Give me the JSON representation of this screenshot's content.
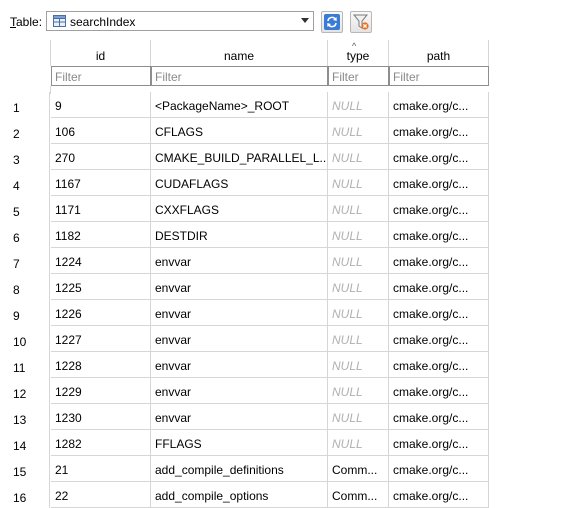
{
  "toolbar": {
    "table_label": "Table:",
    "table_label_accel": "T",
    "table_label_rest": "able:",
    "selected_table": "searchIndex",
    "refresh_icon": "refresh-icon",
    "clear_filter_icon": "filter-clear-icon"
  },
  "columns": [
    {
      "label": "id",
      "filter_placeholder": "Filter"
    },
    {
      "label": "name",
      "filter_placeholder": "Filter"
    },
    {
      "label": "type",
      "filter_placeholder": "Filter",
      "sorted": "ascending"
    },
    {
      "label": "path",
      "filter_placeholder": "Filter"
    }
  ],
  "rows": [
    {
      "num": "1",
      "id": "9",
      "name": "<PackageName>_ROOT",
      "type": "NULL",
      "path": "cmake.org/c..."
    },
    {
      "num": "2",
      "id": "106",
      "name": "CFLAGS",
      "type": "NULL",
      "path": "cmake.org/c..."
    },
    {
      "num": "3",
      "id": "270",
      "name": "CMAKE_BUILD_PARALLEL_L...",
      "type": "NULL",
      "path": "cmake.org/c..."
    },
    {
      "num": "4",
      "id": "1167",
      "name": "CUDAFLAGS",
      "type": "NULL",
      "path": "cmake.org/c..."
    },
    {
      "num": "5",
      "id": "1171",
      "name": "CXXFLAGS",
      "type": "NULL",
      "path": "cmake.org/c..."
    },
    {
      "num": "6",
      "id": "1182",
      "name": "DESTDIR",
      "type": "NULL",
      "path": "cmake.org/c..."
    },
    {
      "num": "7",
      "id": "1224",
      "name": "envvar",
      "type": "NULL",
      "path": "cmake.org/c..."
    },
    {
      "num": "8",
      "id": "1225",
      "name": "envvar",
      "type": "NULL",
      "path": "cmake.org/c..."
    },
    {
      "num": "9",
      "id": "1226",
      "name": "envvar",
      "type": "NULL",
      "path": "cmake.org/c..."
    },
    {
      "num": "10",
      "id": "1227",
      "name": "envvar",
      "type": "NULL",
      "path": "cmake.org/c..."
    },
    {
      "num": "11",
      "id": "1228",
      "name": "envvar",
      "type": "NULL",
      "path": "cmake.org/c..."
    },
    {
      "num": "12",
      "id": "1229",
      "name": "envvar",
      "type": "NULL",
      "path": "cmake.org/c..."
    },
    {
      "num": "13",
      "id": "1230",
      "name": "envvar",
      "type": "NULL",
      "path": "cmake.org/c..."
    },
    {
      "num": "14",
      "id": "1282",
      "name": "FFLAGS",
      "type": "NULL",
      "path": "cmake.org/c..."
    },
    {
      "num": "15",
      "id": "21",
      "name": "add_compile_definitions",
      "type": "Comm...",
      "path": "cmake.org/c..."
    },
    {
      "num": "16",
      "id": "22",
      "name": "add_compile_options",
      "type": "Comm...",
      "path": "cmake.org/c..."
    }
  ]
}
